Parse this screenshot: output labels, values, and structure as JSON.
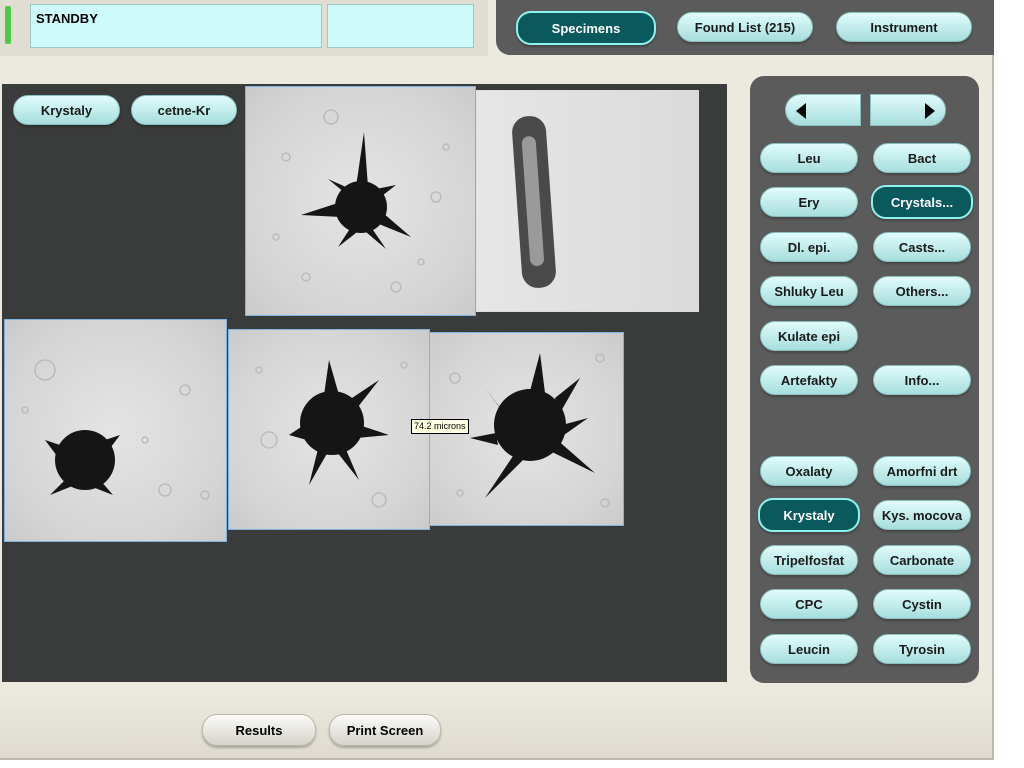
{
  "status": {
    "text": "STANDBY",
    "led_color": "#4fc94a"
  },
  "top_tabs": [
    {
      "label": "Specimens",
      "active": true
    },
    {
      "label": "Found List (215)",
      "active": false
    },
    {
      "label": "Instrument",
      "active": false
    }
  ],
  "viewer": {
    "filter_buttons": [
      "Krystaly",
      "cetne-Kr"
    ],
    "measurement_label": "74.2 microns"
  },
  "category_buttons": [
    {
      "label": "Leu",
      "active": false
    },
    {
      "label": "Bact",
      "active": false
    },
    {
      "label": "Ery",
      "active": false
    },
    {
      "label": "Crystals...",
      "active": true
    },
    {
      "label": "Dl. epi.",
      "active": false
    },
    {
      "label": "Casts...",
      "active": false
    },
    {
      "label": "Shluky Leu",
      "active": false
    },
    {
      "label": "Others...",
      "active": false
    },
    {
      "label": "Kulate epi",
      "active": false
    },
    {
      "label": "Artefakty",
      "active": false
    },
    {
      "label": "Info...",
      "active": false
    }
  ],
  "subcategory_buttons": [
    {
      "label": "Oxalaty",
      "active": false
    },
    {
      "label": "Amorfni drt",
      "active": false
    },
    {
      "label": "Krystaly",
      "active": true
    },
    {
      "label": "Kys. mocova",
      "active": false
    },
    {
      "label": "Tripelfosfat",
      "active": false
    },
    {
      "label": "Carbonate",
      "active": false
    },
    {
      "label": "CPC",
      "active": false
    },
    {
      "label": "Cystin",
      "active": false
    },
    {
      "label": "Leucin",
      "active": false
    },
    {
      "label": "Tyrosin",
      "active": false
    }
  ],
  "bottom_buttons": [
    "Results",
    "Print Screen"
  ],
  "colors": {
    "accent": "#0a5a5d",
    "pill": "#b8ecea",
    "panel": "#5b5b5b",
    "viewer": "#3a3b3b"
  }
}
